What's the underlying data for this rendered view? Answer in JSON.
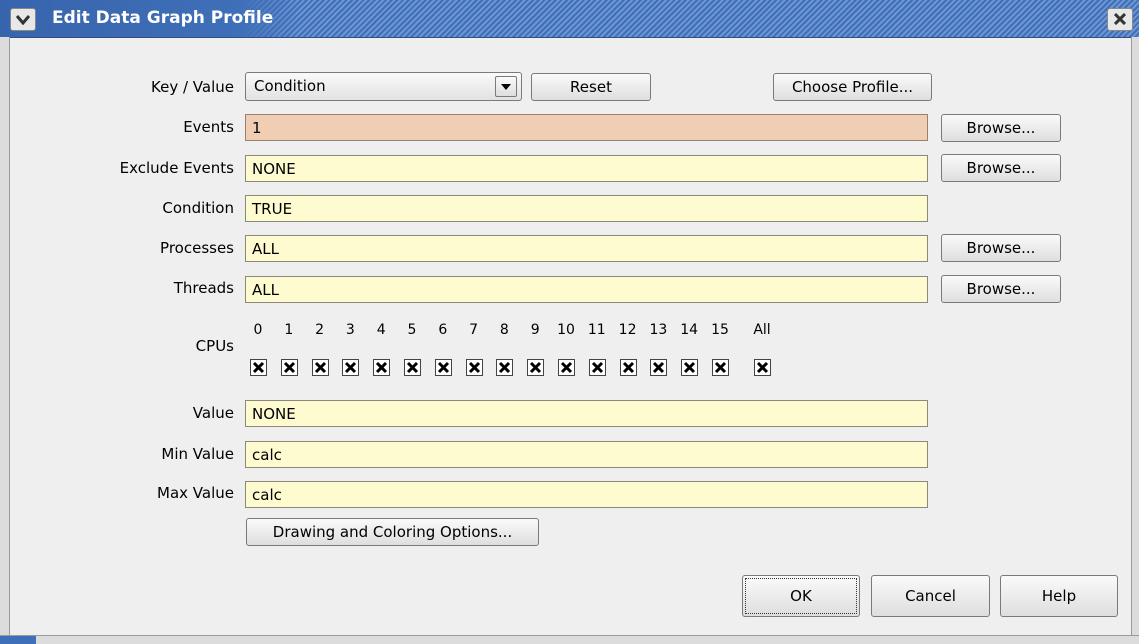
{
  "window": {
    "title": "Edit Data Graph Profile",
    "menu_icon": "chevron-down-icon",
    "close_icon": "close-icon"
  },
  "colors": {
    "titlebar": "#3f6fb8",
    "field_bg": "#fffbd0",
    "events_field_bg": "#efceb4",
    "dialog_bg": "#efefef"
  },
  "form": {
    "key_value": {
      "label": "Key / Value",
      "selected": "Condition",
      "reset_label": "Reset",
      "choose_profile_label": "Choose Profile..."
    },
    "events": {
      "label": "Events",
      "value": "1",
      "browse_label": "Browse..."
    },
    "exclude_events": {
      "label": "Exclude Events",
      "value": "NONE",
      "browse_label": "Browse..."
    },
    "condition": {
      "label": "Condition",
      "value": "TRUE"
    },
    "processes": {
      "label": "Processes",
      "value": "ALL",
      "browse_label": "Browse..."
    },
    "threads": {
      "label": "Threads",
      "value": "ALL",
      "browse_label": "Browse..."
    },
    "cpus": {
      "label": "CPUs",
      "numbers": [
        "0",
        "1",
        "2",
        "3",
        "4",
        "5",
        "6",
        "7",
        "8",
        "9",
        "10",
        "11",
        "12",
        "13",
        "14",
        "15"
      ],
      "checked": [
        true,
        true,
        true,
        true,
        true,
        true,
        true,
        true,
        true,
        true,
        true,
        true,
        true,
        true,
        true,
        true
      ],
      "all_label": "All",
      "all_checked": true
    },
    "value": {
      "label": "Value",
      "value": "NONE"
    },
    "min_value": {
      "label": "Min Value",
      "value": "calc"
    },
    "max_value": {
      "label": "Max Value",
      "value": "calc"
    },
    "drawing_options_label": "Drawing and Coloring Options..."
  },
  "footer": {
    "ok_label": "OK",
    "cancel_label": "Cancel",
    "help_label": "Help"
  }
}
